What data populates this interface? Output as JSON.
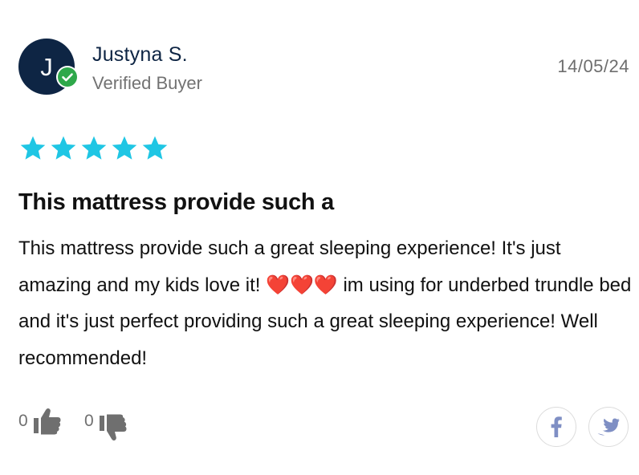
{
  "reviewer": {
    "initial": "J",
    "name": "Justyna S.",
    "status": "Verified Buyer",
    "date": "14/05/24",
    "avatar_color": "#0e2544",
    "badge_color": "#2ea84a",
    "badge_icon": "check-circle-icon"
  },
  "rating": {
    "stars": 5,
    "max": 5,
    "color": "#1fc6e4"
  },
  "review": {
    "title": "This mattress provide such a",
    "body_part1": "This mattress provide such a great sleeping experience! It's just amazing and my kids love it! ",
    "emoji": "❤️❤️❤️",
    "body_part2": " im using for underbed trundle bed and it's just perfect providing such a great sleeping experience! Well recommended!"
  },
  "votes": {
    "up_count": "0",
    "down_count": "0",
    "up_icon": "thumbs-up-icon",
    "down_icon": "thumbs-down-icon"
  },
  "share": {
    "icons": [
      "facebook-icon",
      "twitter-icon"
    ],
    "icon_color": "#7f8fc4"
  }
}
